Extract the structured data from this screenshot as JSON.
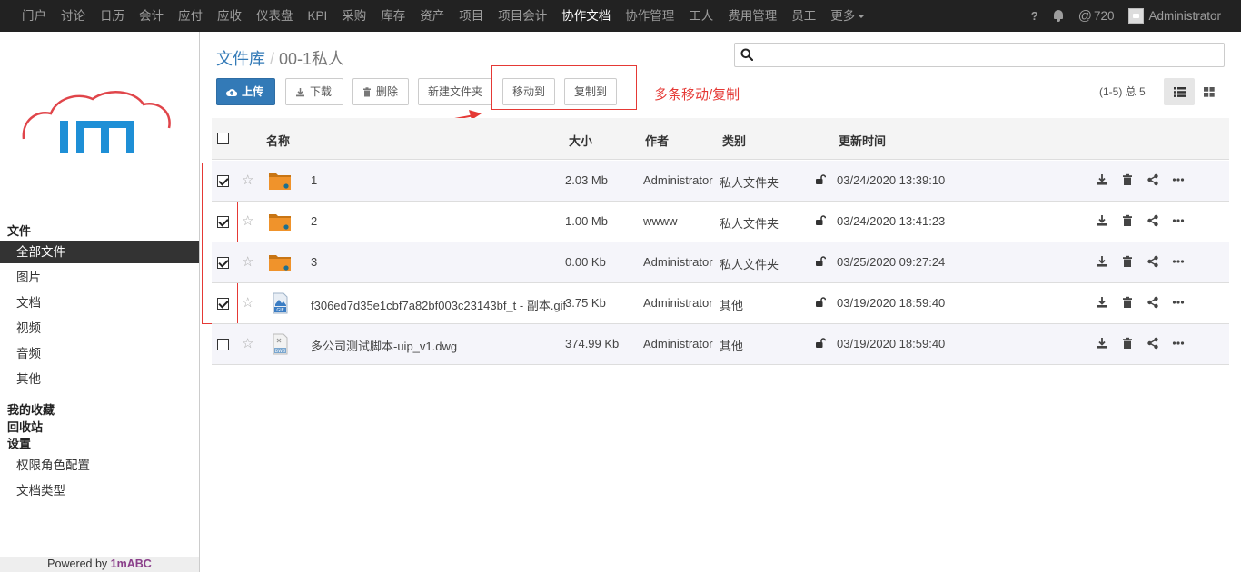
{
  "topnav": {
    "items": [
      "门户",
      "讨论",
      "日历",
      "会计",
      "应付",
      "应收",
      "仪表盘",
      "KPI",
      "采购",
      "库存",
      "资产",
      "项目",
      "项目会计",
      "协作文档",
      "协作管理",
      "工人",
      "费用管理",
      "员工",
      "更多"
    ],
    "active_index": 13,
    "help": "?",
    "messages": "720",
    "user": "Administrator"
  },
  "sidebar": {
    "section_files": "文件",
    "file_items": [
      "全部文件",
      "图片",
      "文档",
      "视频",
      "音频",
      "其他"
    ],
    "active_index": 0,
    "favorites": "我的收藏",
    "recycle": "回收站",
    "settings": "设置",
    "settings_items": [
      "权限角色配置",
      "文档类型"
    ],
    "powered_prefix": "Powered by ",
    "powered_brand": "1mABC"
  },
  "breadcrumb": {
    "root": "文件库",
    "sep": "/",
    "current": "00-1私人"
  },
  "search": {
    "placeholder": "",
    "value": ""
  },
  "toolbar": {
    "upload": "上传",
    "download": "下载",
    "delete": "删除",
    "new_folder": "新建文件夹",
    "move_to": "移动到",
    "copy_to": "复制到"
  },
  "annotation": "多条移动/复制",
  "pager": "(1-5) 总 5",
  "table": {
    "headers": {
      "name": "名称",
      "size": "大小",
      "author": "作者",
      "category": "类别",
      "updated": "更新时间"
    },
    "rows": [
      {
        "name": "1",
        "size": "2.03 Mb",
        "author": "Administrator",
        "category": "私人文件夹",
        "updated": "03/24/2020 13:39:10",
        "checked": true,
        "type": "folder"
      },
      {
        "name": "2",
        "size": "1.00 Mb",
        "author": "wwww",
        "category": "私人文件夹",
        "updated": "03/24/2020 13:41:23",
        "checked": true,
        "type": "folder"
      },
      {
        "name": "3",
        "size": "0.00 Kb",
        "author": "Administrator",
        "category": "私人文件夹",
        "updated": "03/25/2020 09:27:24",
        "checked": true,
        "type": "folder"
      },
      {
        "name": "f306ed7d35e1cbf7a82bf003c23143bf_t - 副本.gif",
        "size": "3.75 Kb",
        "author": "Administrator",
        "category": "其他",
        "updated": "03/19/2020 18:59:40",
        "checked": true,
        "type": "gif"
      },
      {
        "name": "多公司测试脚本-uip_v1.dwg",
        "size": "374.99 Kb",
        "author": "Administrator",
        "category": "其他",
        "updated": "03/19/2020 18:59:40",
        "checked": false,
        "type": "dwg"
      }
    ]
  },
  "colors": {
    "nav_bg": "#222222",
    "primary": "#337ab7",
    "annotation": "#e53935",
    "folder": "#f0932b",
    "logo_blue": "#1e8fd6",
    "logo_red": "#e0454a"
  }
}
